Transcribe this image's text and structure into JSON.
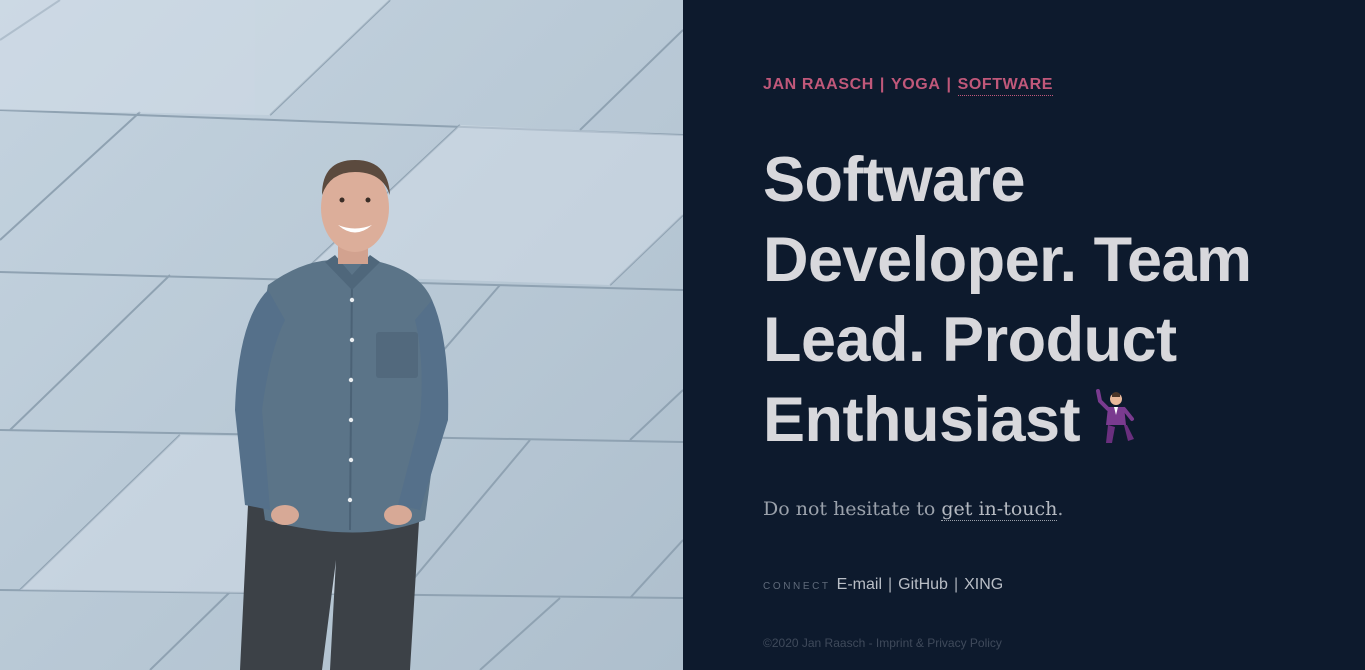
{
  "photo": {
    "alt_icon": "portrait-photo"
  },
  "breadcrumb": {
    "items": [
      "JAN RAASCH",
      "YOGA",
      "SOFTWARE"
    ],
    "separator": "|"
  },
  "headline": {
    "lines": [
      "Software",
      "Developer. Team",
      "Lead. Product",
      "Enthusiast"
    ],
    "emoji": "dancing-man-icon"
  },
  "tagline": {
    "prefix": "Do not hesitate to ",
    "link": "get in-touch",
    "suffix": "."
  },
  "connect": {
    "label": "CONNECT",
    "links": [
      "E-mail",
      "GitHub",
      "XING"
    ],
    "separator": "|"
  },
  "footer": {
    "text": "©2020 Jan Raasch - Imprint & Privacy Policy"
  },
  "colors": {
    "background": "#0d1a2d",
    "accent": "#c0587a",
    "headline": "#d8d8dc"
  }
}
